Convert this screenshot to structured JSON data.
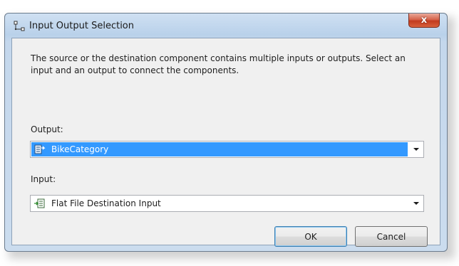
{
  "window": {
    "title": "Input Output Selection",
    "icon": "connection-icon",
    "close_icon": "close-icon",
    "close_glyph": "x"
  },
  "dialog": {
    "message": "The source or the destination component contains multiple inputs or outputs. Select an input and an output to connect the components.",
    "output_label": "Output:",
    "output_value": "BikeCategory",
    "input_label": "Input:",
    "input_value": "Flat File Destination Input",
    "ok_label": "OK",
    "cancel_label": "Cancel"
  },
  "colors": {
    "selection": "#3399ff",
    "client_bg": "#f0f0f0",
    "close_red": "#c23b1e"
  }
}
